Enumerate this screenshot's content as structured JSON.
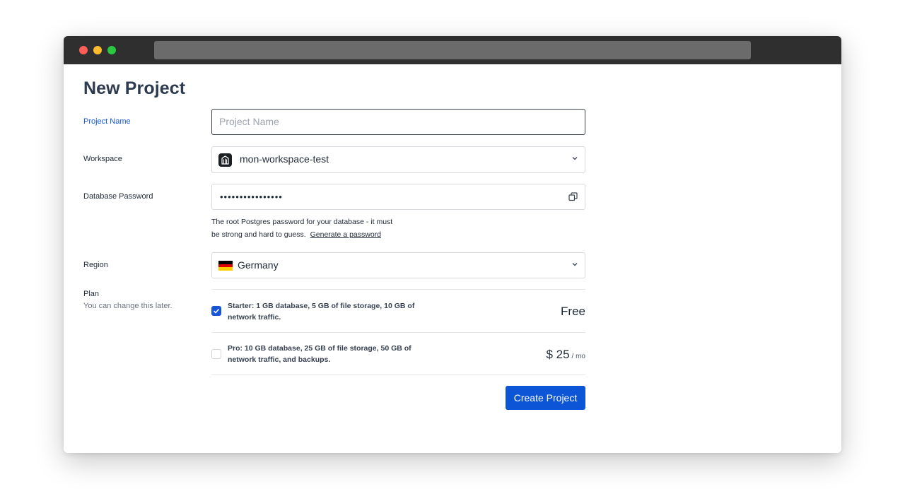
{
  "page": {
    "title": "New Project"
  },
  "form": {
    "project_name": {
      "label": "Project Name",
      "placeholder": "Project Name",
      "value": ""
    },
    "workspace": {
      "label": "Workspace",
      "value": "mon-workspace-test",
      "icon": "workspace-icon"
    },
    "database_password": {
      "label": "Database Password",
      "value": "••••••••••••••••",
      "copy_icon": "copy-icon",
      "help_line1": "The root Postgres password for your database - it must",
      "help_line2": "be strong and hard to guess.",
      "generate_link": "Generate a password"
    },
    "region": {
      "label": "Region",
      "value": "Germany",
      "flag_colors": [
        "#000000",
        "#dd0000",
        "#ffce00"
      ]
    },
    "plan": {
      "label": "Plan",
      "subtitle": "You can change this later.",
      "options": [
        {
          "checked": true,
          "line1": "Starter: 1 GB database, 5 GB of file storage, 10 GB of",
          "line2": "network traffic.",
          "price": "Free",
          "per": ""
        },
        {
          "checked": false,
          "line1": "Pro: 10 GB database, 25 GB of file storage, 50 GB of",
          "line2": "network traffic, and backups.",
          "price": "$ 25",
          "per": "/ mo"
        }
      ]
    },
    "submit_label": "Create Project"
  },
  "colors": {
    "accent": "#0b55d6",
    "label_active": "#1656d6",
    "titlebar": "#2f2f2f"
  }
}
